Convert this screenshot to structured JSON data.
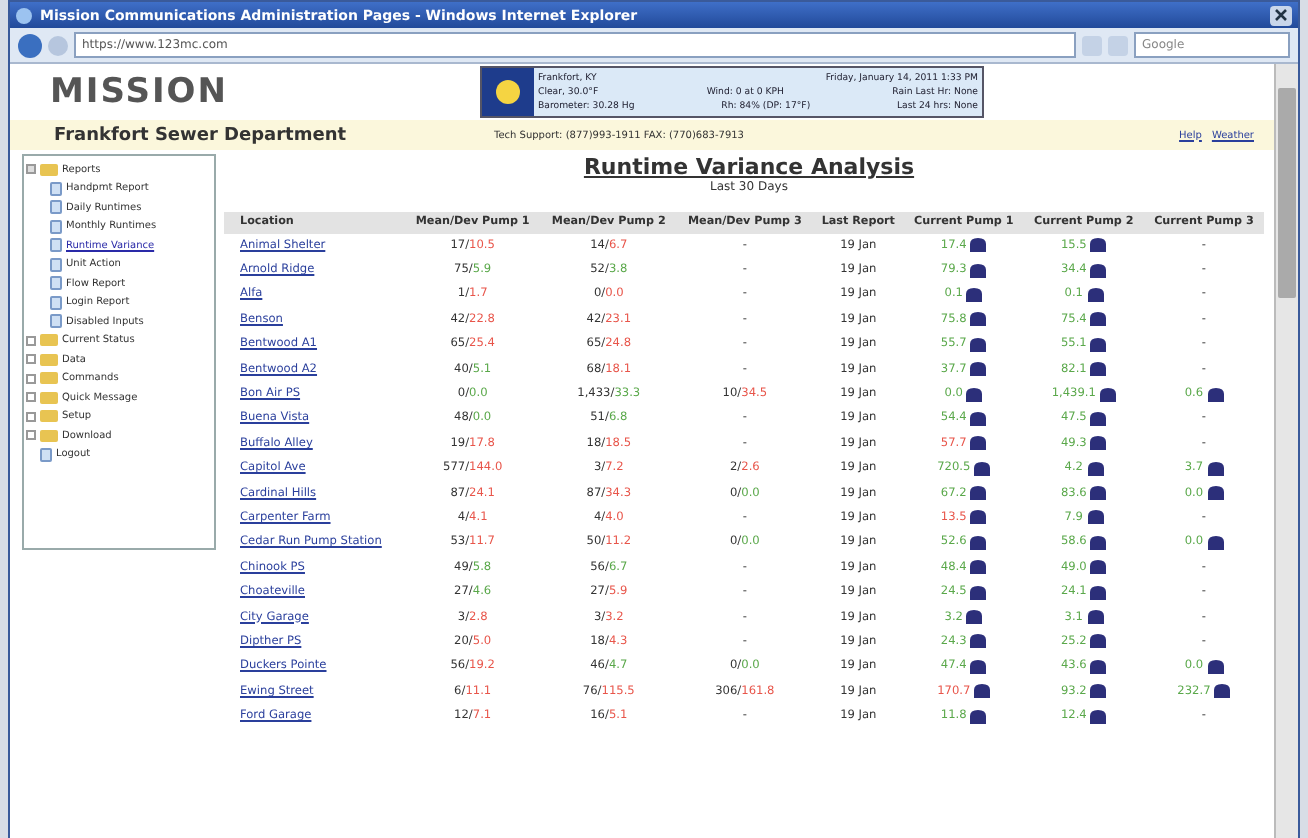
{
  "window": {
    "title": "Mission Communications Administration Pages - Windows Internet Explorer",
    "address": "https://www.123mc.com",
    "search_placeholder": "Google"
  },
  "header": {
    "logo": "MISSION",
    "weather": {
      "lines": [
        [
          "Frankfort, KY",
          "Friday, January 14, 2011 1:33 PM"
        ],
        [
          "Clear, 30.0°F",
          "Wind: 0 at 0 KPH",
          "Rain Last Hr: None"
        ],
        [
          "Barometer: 30.28 Hg",
          "Rh: 84% (DP: 17°F)",
          "Last 24 hrs: None"
        ]
      ]
    }
  },
  "band": {
    "department": "Frankfort Sewer Department",
    "support": "Tech Support: (877)993-1911 FAX: (770)683-7913",
    "links": [
      "Help",
      "Weather"
    ]
  },
  "sidebar": {
    "items": [
      {
        "label": "Reports",
        "kind": "folder",
        "expanded": true,
        "children": [
          {
            "label": "Handpmt Report",
            "kind": "page",
            "selected": false
          },
          {
            "label": "Daily Runtimes",
            "kind": "page",
            "selected": false
          },
          {
            "label": "Monthly Runtimes",
            "kind": "page",
            "selected": false
          },
          {
            "label": "Runtime Variance",
            "kind": "page",
            "selected": true
          },
          {
            "label": "Unit Action",
            "kind": "page",
            "selected": false
          },
          {
            "label": "Flow Report",
            "kind": "page",
            "selected": false
          },
          {
            "label": "Login Report",
            "kind": "page",
            "selected": false
          },
          {
            "label": "Disabled Inputs",
            "kind": "page",
            "selected": false
          }
        ]
      },
      {
        "label": "Current Status",
        "kind": "folder",
        "expanded": false
      },
      {
        "label": "Data",
        "kind": "folder",
        "expanded": false
      },
      {
        "label": "Commands",
        "kind": "folder",
        "expanded": false
      },
      {
        "label": "Quick Message",
        "kind": "folder",
        "expanded": false
      },
      {
        "label": "Setup",
        "kind": "folder",
        "expanded": false
      },
      {
        "label": "Download",
        "kind": "folder",
        "expanded": false
      },
      {
        "label": "Logout",
        "kind": "page",
        "selected": false
      }
    ]
  },
  "report": {
    "title": "Runtime Variance Analysis",
    "subtitle": "Last 30 Days",
    "columns": [
      "Location",
      "Mean/Dev Pump 1",
      "Mean/Dev Pump 2",
      "Mean/Dev Pump 3",
      "Last Report",
      "Current Pump 1",
      "Current Pump 2",
      "Current Pump 3"
    ],
    "rows": [
      {
        "location": "Animal Shelter",
        "means": [
          {
            "mean": "17/",
            "dev": "10.5",
            "color": "#e8554a"
          },
          {
            "mean": "14/",
            "dev": "6.7",
            "color": "#e8554a"
          },
          {
            "text": "-"
          }
        ],
        "last": "19 Jan",
        "current": [
          {
            "value": "17.4",
            "color": "#5aa84a"
          },
          {
            "value": "15.5",
            "color": "#5aa84a"
          },
          {
            "text": "-"
          }
        ]
      },
      {
        "location": "Arnold Ridge",
        "means": [
          {
            "mean": "75/",
            "dev": "5.9",
            "color": "#5aa84a"
          },
          {
            "mean": "52/",
            "dev": "3.8",
            "color": "#5aa84a"
          },
          {
            "text": "-"
          }
        ],
        "last": "19 Jan",
        "current": [
          {
            "value": "79.3",
            "color": "#5aa84a"
          },
          {
            "value": "34.4",
            "color": "#5aa84a"
          },
          {
            "text": "-"
          }
        ]
      },
      {
        "location": "Alfa",
        "means": [
          {
            "mean": "1/",
            "dev": "1.7",
            "color": "#e8554a"
          },
          {
            "mean": "0/",
            "dev": "0.0",
            "color": "#e8554a"
          },
          {
            "text": "-"
          }
        ],
        "last": "19 Jan",
        "current": [
          {
            "value": "0.1",
            "color": "#5aa84a"
          },
          {
            "value": "0.1",
            "color": "#5aa84a"
          },
          {
            "text": "-"
          }
        ]
      },
      {
        "location": "Benson",
        "means": [
          {
            "mean": "42/",
            "dev": "22.8",
            "color": "#e8554a"
          },
          {
            "mean": "42/",
            "dev": "23.1",
            "color": "#e8554a"
          },
          {
            "text": "-"
          }
        ],
        "last": "19 Jan",
        "current": [
          {
            "value": "75.8",
            "color": "#5aa84a"
          },
          {
            "value": "75.4",
            "color": "#5aa84a"
          },
          {
            "text": "-"
          }
        ]
      },
      {
        "location": "Bentwood A1",
        "means": [
          {
            "mean": "65/",
            "dev": "25.4",
            "color": "#e8554a"
          },
          {
            "mean": "65/",
            "dev": "24.8",
            "color": "#e8554a"
          },
          {
            "text": "-"
          }
        ],
        "last": "19 Jan",
        "current": [
          {
            "value": "55.7",
            "color": "#5aa84a"
          },
          {
            "value": "55.1",
            "color": "#5aa84a"
          },
          {
            "text": "-"
          }
        ]
      },
      {
        "location": "Bentwood A2",
        "means": [
          {
            "mean": "40/",
            "dev": "5.1",
            "color": "#5aa84a"
          },
          {
            "mean": "68/",
            "dev": "18.1",
            "color": "#e8554a"
          },
          {
            "text": "-"
          }
        ],
        "last": "19 Jan",
        "current": [
          {
            "value": "37.7",
            "color": "#5aa84a"
          },
          {
            "value": "82.1",
            "color": "#5aa84a"
          },
          {
            "text": "-"
          }
        ]
      },
      {
        "location": "Bon Air PS",
        "means": [
          {
            "mean": "0/",
            "dev": "0.0",
            "color": "#5aa84a"
          },
          {
            "mean": "1,433/",
            "dev": "33.3",
            "color": "#5aa84a"
          },
          {
            "mean": "10/",
            "dev": "34.5",
            "color": "#e8554a"
          }
        ],
        "last": "19 Jan",
        "current": [
          {
            "value": "0.0",
            "color": "#5aa84a"
          },
          {
            "value": "1,439.1",
            "color": "#5aa84a"
          },
          {
            "value": "0.6",
            "color": "#5aa84a"
          }
        ]
      },
      {
        "location": "Buena Vista",
        "means": [
          {
            "mean": "48/",
            "dev": "0.0",
            "color": "#5aa84a"
          },
          {
            "mean": "51/",
            "dev": "6.8",
            "color": "#5aa84a"
          },
          {
            "text": "-"
          }
        ],
        "last": "19 Jan",
        "current": [
          {
            "value": "54.4",
            "color": "#5aa84a"
          },
          {
            "value": "47.5",
            "color": "#5aa84a"
          },
          {
            "text": "-"
          }
        ]
      },
      {
        "location": "Buffalo Alley",
        "means": [
          {
            "mean": "19/",
            "dev": "17.8",
            "color": "#e8554a"
          },
          {
            "mean": "18/",
            "dev": "18.5",
            "color": "#e8554a"
          },
          {
            "text": "-"
          }
        ],
        "last": "19 Jan",
        "current": [
          {
            "value": "57.7",
            "color": "#e8554a"
          },
          {
            "value": "49.3",
            "color": "#5aa84a"
          },
          {
            "text": "-"
          }
        ]
      },
      {
        "location": "Capitol Ave",
        "means": [
          {
            "mean": "577/",
            "dev": "144.0",
            "color": "#e8554a"
          },
          {
            "mean": "3/",
            "dev": "7.2",
            "color": "#e8554a"
          },
          {
            "mean": "2/",
            "dev": "2.6",
            "color": "#e8554a"
          }
        ],
        "last": "19 Jan",
        "current": [
          {
            "value": "720.5",
            "color": "#5aa84a"
          },
          {
            "value": "4.2",
            "color": "#5aa84a"
          },
          {
            "value": "3.7",
            "color": "#5aa84a"
          }
        ]
      },
      {
        "location": "Cardinal Hills",
        "means": [
          {
            "mean": "87/",
            "dev": "24.1",
            "color": "#e8554a"
          },
          {
            "mean": "87/",
            "dev": "34.3",
            "color": "#e8554a"
          },
          {
            "mean": "0/",
            "dev": "0.0",
            "color": "#5aa84a"
          }
        ],
        "last": "19 Jan",
        "current": [
          {
            "value": "67.2",
            "color": "#5aa84a"
          },
          {
            "value": "83.6",
            "color": "#5aa84a"
          },
          {
            "value": "0.0",
            "color": "#5aa84a"
          }
        ]
      },
      {
        "location": "Carpenter Farm",
        "means": [
          {
            "mean": "4/",
            "dev": "4.1",
            "color": "#e8554a"
          },
          {
            "mean": "4/",
            "dev": "4.0",
            "color": "#e8554a"
          },
          {
            "text": "-"
          }
        ],
        "last": "19 Jan",
        "current": [
          {
            "value": "13.5",
            "color": "#e8554a"
          },
          {
            "value": "7.9",
            "color": "#5aa84a"
          },
          {
            "text": "-"
          }
        ]
      },
      {
        "location": "Cedar Run Pump Station",
        "means": [
          {
            "mean": "53/",
            "dev": "11.7",
            "color": "#e8554a"
          },
          {
            "mean": "50/",
            "dev": "11.2",
            "color": "#e8554a"
          },
          {
            "mean": "0/",
            "dev": "0.0",
            "color": "#5aa84a"
          }
        ],
        "last": "19 Jan",
        "current": [
          {
            "value": "52.6",
            "color": "#5aa84a"
          },
          {
            "value": "58.6",
            "color": "#5aa84a"
          },
          {
            "value": "0.0",
            "color": "#5aa84a"
          }
        ]
      },
      {
        "location": "Chinook PS",
        "means": [
          {
            "mean": "49/",
            "dev": "5.8",
            "color": "#5aa84a"
          },
          {
            "mean": "56/",
            "dev": "6.7",
            "color": "#5aa84a"
          },
          {
            "text": "-"
          }
        ],
        "last": "19 Jan",
        "current": [
          {
            "value": "48.4",
            "color": "#5aa84a"
          },
          {
            "value": "49.0",
            "color": "#5aa84a"
          },
          {
            "text": "-"
          }
        ]
      },
      {
        "location": "Choateville",
        "means": [
          {
            "mean": "27/",
            "dev": "4.6",
            "color": "#5aa84a"
          },
          {
            "mean": "27/",
            "dev": "5.9",
            "color": "#e8554a"
          },
          {
            "text": "-"
          }
        ],
        "last": "19 Jan",
        "current": [
          {
            "value": "24.5",
            "color": "#5aa84a"
          },
          {
            "value": "24.1",
            "color": "#5aa84a"
          },
          {
            "text": "-"
          }
        ]
      },
      {
        "location": "City Garage",
        "means": [
          {
            "mean": "3/",
            "dev": "2.8",
            "color": "#e8554a"
          },
          {
            "mean": "3/",
            "dev": "3.2",
            "color": "#e8554a"
          },
          {
            "text": "-"
          }
        ],
        "last": "19 Jan",
        "current": [
          {
            "value": "3.2",
            "color": "#5aa84a"
          },
          {
            "value": "3.1",
            "color": "#5aa84a"
          },
          {
            "text": "-"
          }
        ]
      },
      {
        "location": "Dipther PS",
        "means": [
          {
            "mean": "20/",
            "dev": "5.0",
            "color": "#e8554a"
          },
          {
            "mean": "18/",
            "dev": "4.3",
            "color": "#e8554a"
          },
          {
            "text": "-"
          }
        ],
        "last": "19 Jan",
        "current": [
          {
            "value": "24.3",
            "color": "#5aa84a"
          },
          {
            "value": "25.2",
            "color": "#5aa84a"
          },
          {
            "text": "-"
          }
        ]
      },
      {
        "location": "Duckers Pointe",
        "means": [
          {
            "mean": "56/",
            "dev": "19.2",
            "color": "#e8554a"
          },
          {
            "mean": "46/",
            "dev": "4.7",
            "color": "#5aa84a"
          },
          {
            "mean": "0/",
            "dev": "0.0",
            "color": "#5aa84a"
          }
        ],
        "last": "19 Jan",
        "current": [
          {
            "value": "47.4",
            "color": "#5aa84a"
          },
          {
            "value": "43.6",
            "color": "#5aa84a"
          },
          {
            "value": "0.0",
            "color": "#5aa84a"
          }
        ]
      },
      {
        "location": "Ewing Street",
        "means": [
          {
            "mean": "6/",
            "dev": "11.1",
            "color": "#e8554a"
          },
          {
            "mean": "76/",
            "dev": "115.5",
            "color": "#e8554a"
          },
          {
            "mean": "306/",
            "dev": "161.8",
            "color": "#e8554a"
          }
        ],
        "last": "19 Jan",
        "current": [
          {
            "value": "170.7",
            "color": "#e8554a"
          },
          {
            "value": "93.2",
            "color": "#5aa84a"
          },
          {
            "value": "232.7",
            "color": "#5aa84a"
          }
        ]
      },
      {
        "location": "Ford Garage",
        "means": [
          {
            "mean": "12/",
            "dev": "7.1",
            "color": "#e8554a"
          },
          {
            "mean": "16/",
            "dev": "5.1",
            "color": "#e8554a"
          },
          {
            "text": "-"
          }
        ],
        "last": "19 Jan",
        "current": [
          {
            "value": "11.8",
            "color": "#5aa84a"
          },
          {
            "value": "12.4",
            "color": "#5aa84a"
          },
          {
            "text": "-"
          }
        ]
      }
    ]
  }
}
